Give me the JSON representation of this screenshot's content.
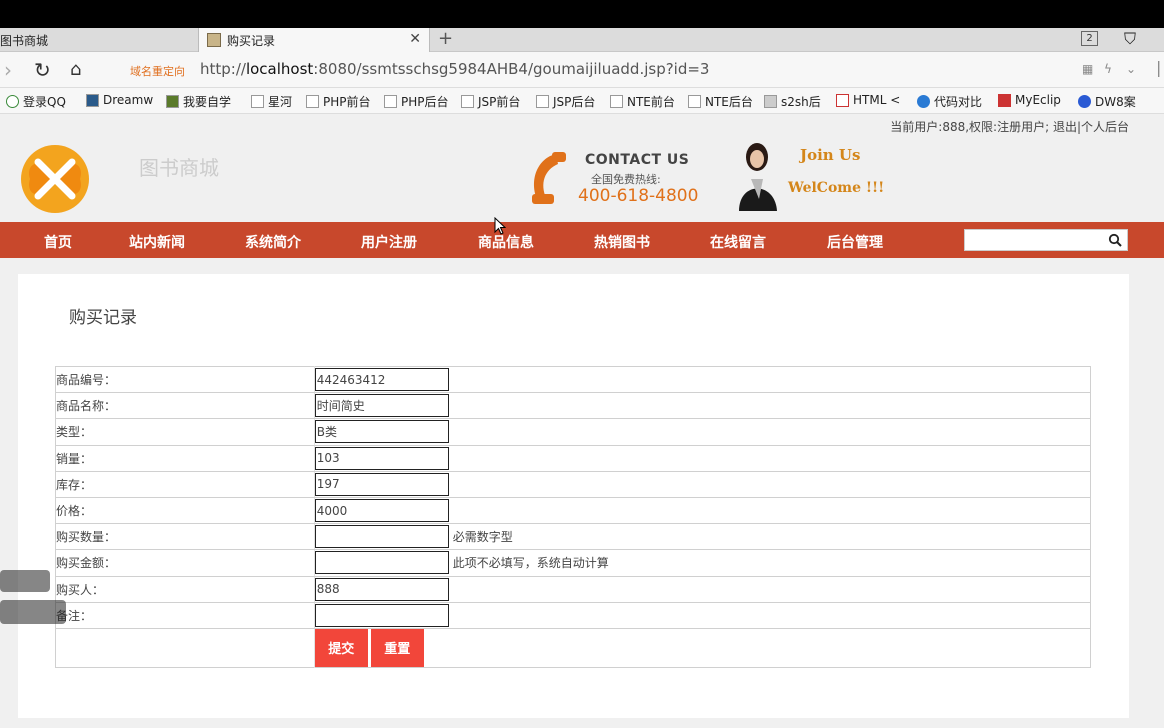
{
  "browser": {
    "tabs": [
      {
        "label": "图书商城",
        "active": false
      },
      {
        "label": "购买记录",
        "active": true
      }
    ],
    "new_tab_label": "+",
    "tab_count": "2",
    "redirect_label": "域名重定向",
    "url_prefix": "http://",
    "url_host": "localhost",
    "url_rest": ":8080/ssmtsschsg5984AHB4/goumaijiluadd.jsp?id=3",
    "bookmarks": [
      "登录QQ",
      "Dreamw",
      "我要自学",
      "星河",
      "PHP前台",
      "PHP后台",
      "JSP前台",
      "JSP后台",
      "NTE前台",
      "NTE后台",
      "s2sh后",
      "HTML <",
      "代码对比",
      "MyEclip",
      "DW8案"
    ]
  },
  "header": {
    "user_info": "当前用户:888,权限:注册用户; 退出|个人后台",
    "site_name": "图书商城",
    "contact_title": "CONTACT US",
    "contact_sub": "全国免费热线:",
    "contact_phone": "400-618-4800",
    "join_us": "Join Us",
    "welcome": "WelCome !!!"
  },
  "nav": {
    "items": [
      "首页",
      "站内新闻",
      "系统简介",
      "用户注册",
      "商品信息",
      "热销图书",
      "在线留言",
      "后台管理"
    ],
    "search_placeholder": ""
  },
  "form": {
    "title": "购买记录",
    "rows": [
      {
        "label": "商品编号：",
        "value": "442463412",
        "hint": ""
      },
      {
        "label": "商品名称：",
        "value": "时间简史",
        "hint": ""
      },
      {
        "label": "类型：",
        "value": "B类",
        "hint": ""
      },
      {
        "label": "销量：",
        "value": "103",
        "hint": ""
      },
      {
        "label": "库存：",
        "value": "197",
        "hint": ""
      },
      {
        "label": "价格：",
        "value": "4000",
        "hint": ""
      },
      {
        "label": "购买数量：",
        "value": "",
        "hint": "必需数字型"
      },
      {
        "label": "购买金额：",
        "value": "",
        "hint": "此项不必填写，系统自动计算"
      },
      {
        "label": "购买人：",
        "value": "888",
        "hint": ""
      },
      {
        "label": "备注：",
        "value": "",
        "hint": ""
      }
    ],
    "submit_label": "提交",
    "reset_label": "重置"
  },
  "colors": {
    "nav_bg": "#c8482c",
    "button_bg": "#f2463a",
    "accent_orange": "#e0711a"
  }
}
